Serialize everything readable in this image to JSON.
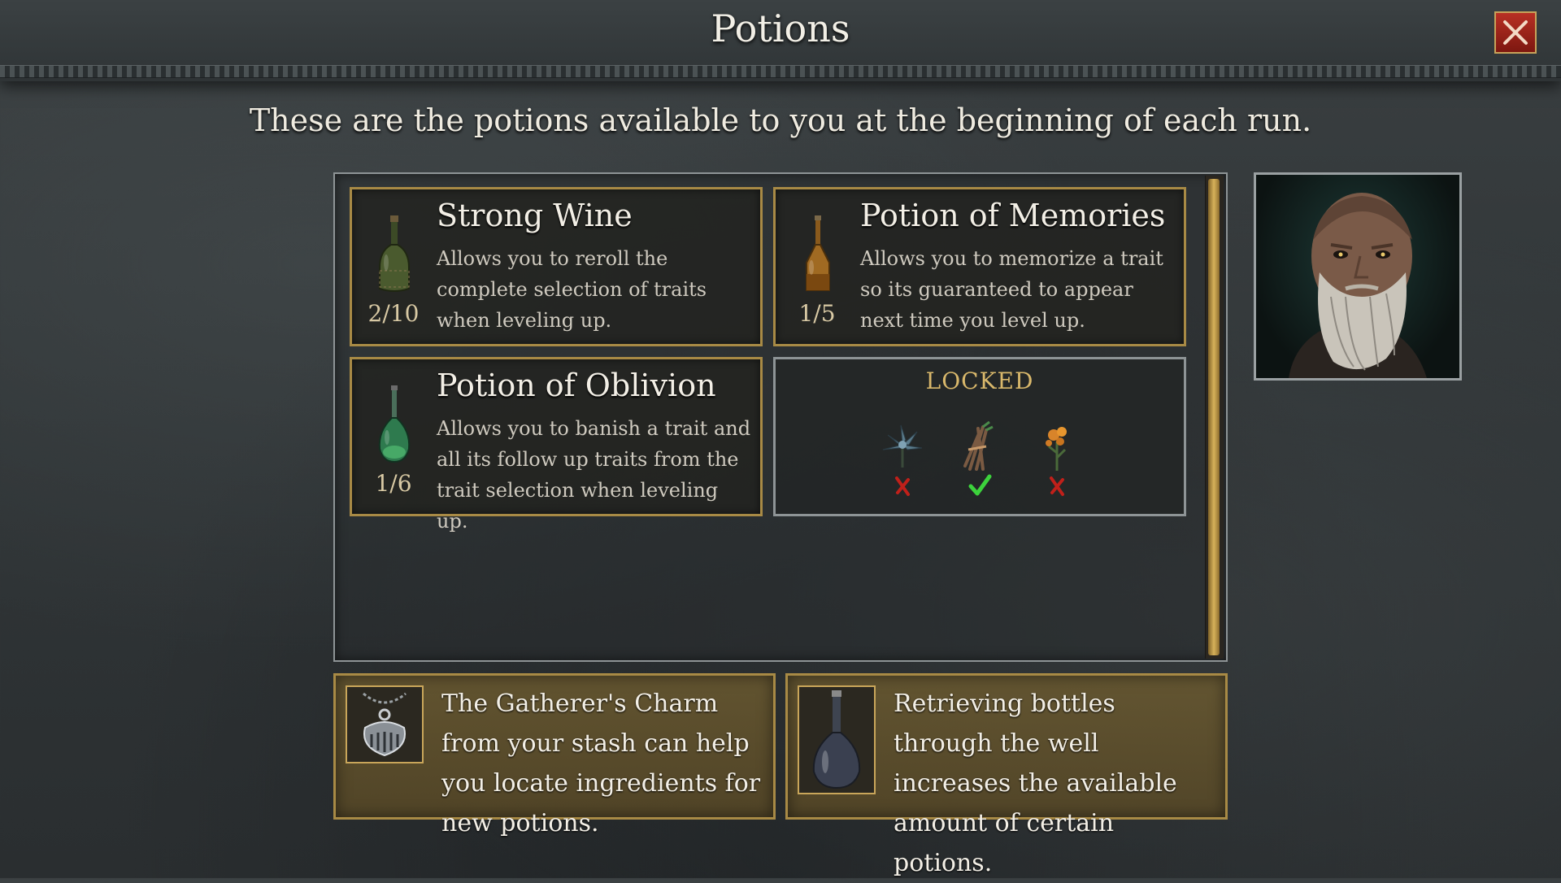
{
  "header": {
    "title": "Potions"
  },
  "subtitle": "These are the potions available to you at the beginning of each run.",
  "potions": [
    {
      "name": "Strong Wine",
      "count": "2/10",
      "description": "Allows you to reroll the complete selection of traits when leveling up.",
      "icon": "wine-bottle-icon",
      "color": "#4a5a2e"
    },
    {
      "name": "Potion of Memories",
      "count": "1/5",
      "description": "Allows you to memorize a trait so its guaranteed to appear next time you level up.",
      "icon": "memories-potion-icon",
      "color": "#a06a22"
    },
    {
      "name": "Potion of Oblivion",
      "count": "1/6",
      "description": "Allows you to  banish a trait and all its follow up traits from the trait selection when leveling up.",
      "icon": "oblivion-potion-icon",
      "color": "#2e7a4e"
    }
  ],
  "locked": {
    "label": "LOCKED",
    "ingredients": [
      {
        "icon": "blue-herb-icon",
        "status": "missing"
      },
      {
        "icon": "root-bundle-icon",
        "status": "found"
      },
      {
        "icon": "orange-flower-icon",
        "status": "missing"
      }
    ]
  },
  "info": [
    {
      "icon": "gatherers-charm-icon",
      "text": "The Gatherer's Charm from your stash can help you locate ingredients for new potions."
    },
    {
      "icon": "empty-bottle-icon",
      "text": "Retrieving bottles through the well increases the available amount of certain potions."
    }
  ],
  "colors": {
    "gold": "#a88a45",
    "locked_text": "#d9b86b",
    "check": "#3cd23c",
    "cross": "#c0201a",
    "close": "#b83024"
  }
}
